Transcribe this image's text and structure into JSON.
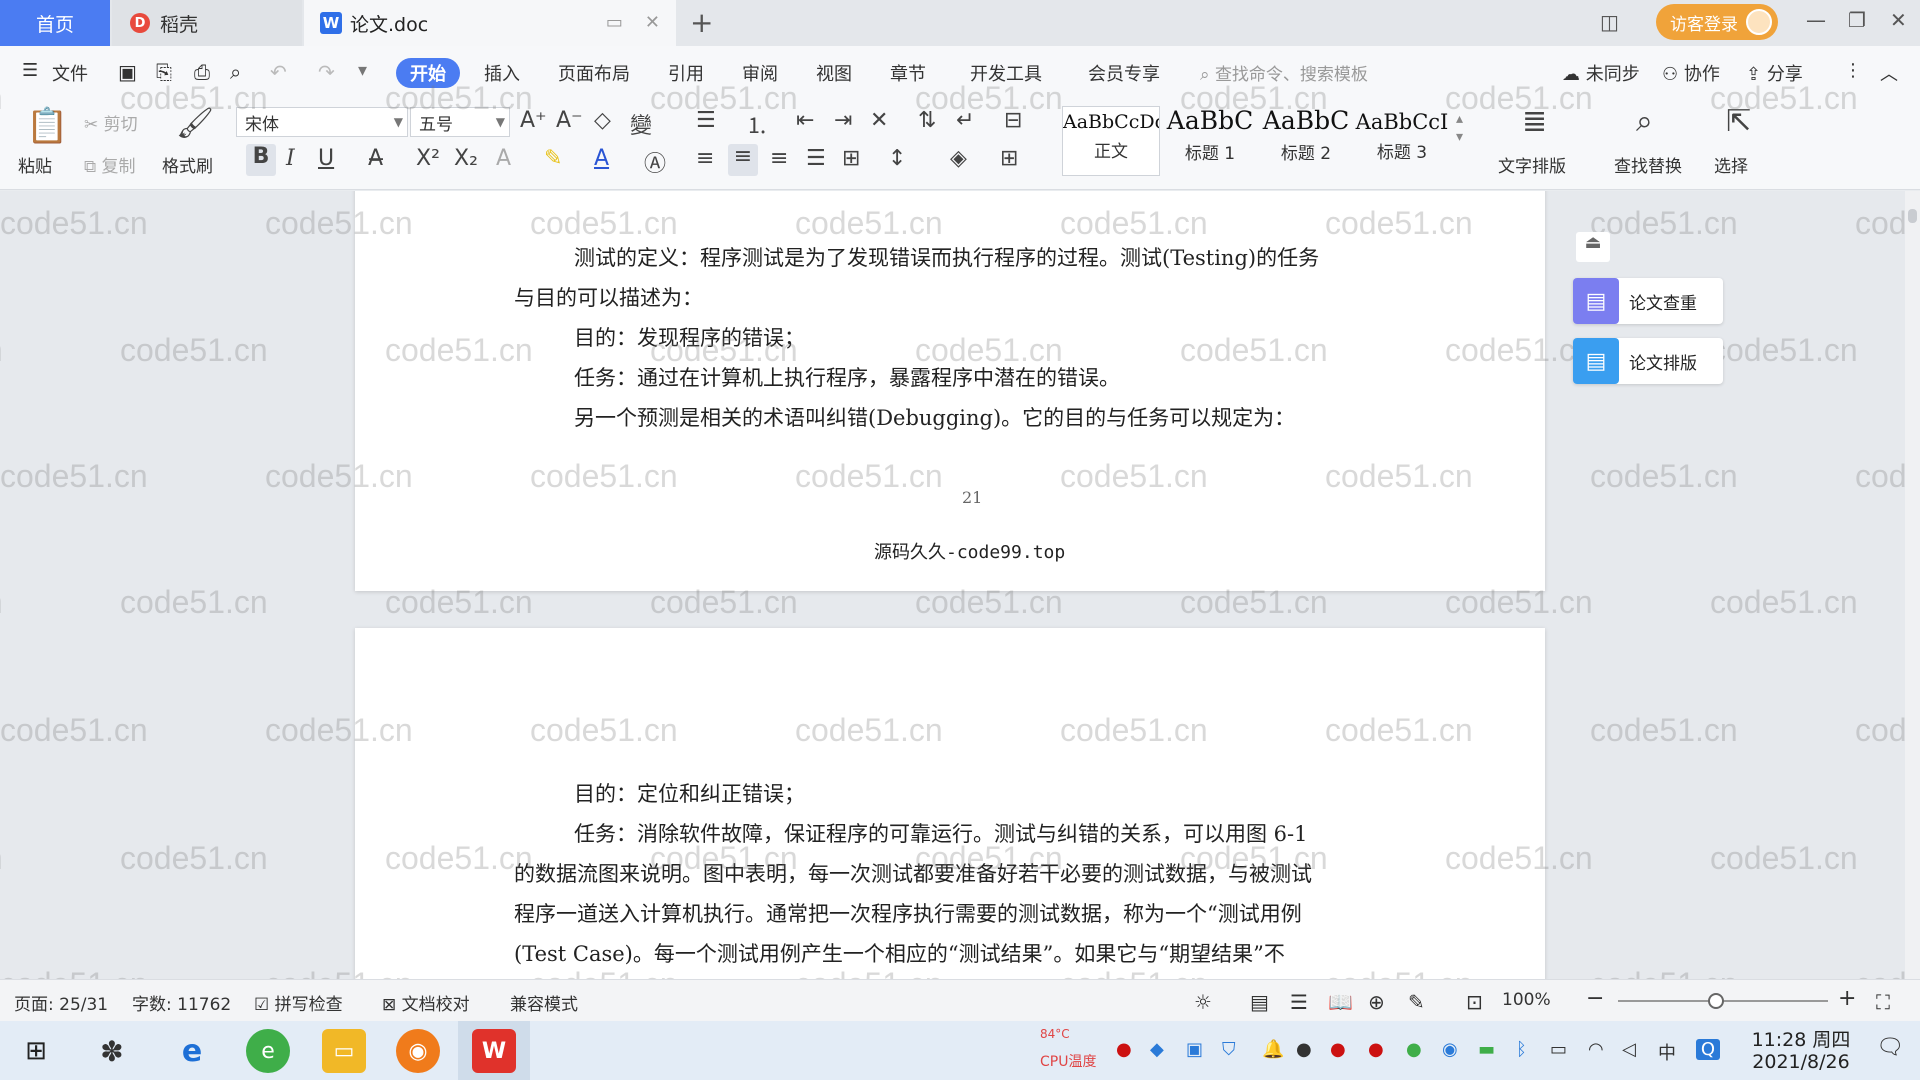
{
  "tabs": {
    "home": "首页",
    "daoke": "稻壳",
    "doc": "论文.doc"
  },
  "account": {
    "visitor_login": "访客登录"
  },
  "menu": {
    "file": "文件",
    "items": [
      "开始",
      "插入",
      "页面布局",
      "引用",
      "审阅",
      "视图",
      "章节",
      "开发工具",
      "会员专享"
    ],
    "search_placeholder": "查找命令、搜索模板",
    "sync": "未同步",
    "collab": "协作",
    "share": "分享"
  },
  "ribbon": {
    "paste": "粘贴",
    "cut": "剪切",
    "copy": "复制",
    "format_painter": "格式刷",
    "font_name": "宋体",
    "font_size": "五号",
    "styles": [
      {
        "preview": "AaBbCcDd",
        "label": "正文"
      },
      {
        "preview": "AaBbC",
        "label": "标题 1"
      },
      {
        "preview": "AaBbC",
        "label": "标题 2"
      },
      {
        "preview": "AaBbCcI",
        "label": "标题 3"
      }
    ],
    "text_layout": "文字排版",
    "find_replace": "查找替换",
    "select": "选择"
  },
  "side_panel": {
    "check": "论文查重",
    "layout": "论文排版"
  },
  "page1": {
    "lines": [
      "测试的定义：程序测试是为了发现错误而执行程序的过程。测试(Testing)的任务",
      "与目的可以描述为：",
      "目的：发现程序的错误；",
      "任务：通过在计算机上执行程序，暴露程序中潜在的错误。",
      "另一个预测是相关的术语叫纠错(Debugging)。它的目的与任务可以规定为："
    ],
    "page_number": "21",
    "footer": "源码久久-code99.top"
  },
  "page2": {
    "lines": [
      "目的：定位和纠正错误；",
      "任务：消除软件故障，保证程序的可靠运行。测试与纠错的关系，可以用图 6-1",
      "的数据流图来说明。图中表明，每一次测试都要准备好若干必要的测试数据，与被测试",
      "程序一道送入计算机执行。通常把一次程序执行需要的测试数据，称为一个“测试用例",
      "(Test Case)。每一个测试用例产生一个相应的“测试结果”。如果它与“期望结果”不"
    ]
  },
  "watermark": "code51.cn",
  "status": {
    "page": "页面: 25/31",
    "words": "字数: 11762",
    "spell": "拼写检查",
    "proof": "文档校对",
    "compat": "兼容模式",
    "zoom": "100%"
  },
  "taskbar": {
    "time": "11:28 周四",
    "date": "2021/8/26",
    "temp": "84°C",
    "cpu": "CPU温度",
    "ime": "中"
  }
}
